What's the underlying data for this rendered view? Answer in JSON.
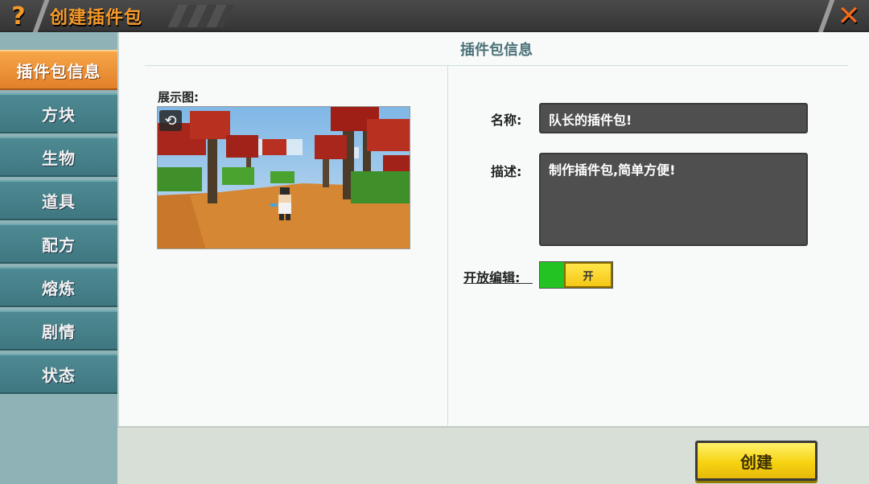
{
  "header": {
    "help_icon": "question-mark-icon",
    "help_glyph": "?",
    "title": "创建插件包",
    "close_icon": "close-icon",
    "close_glyph": "✕"
  },
  "sidebar": {
    "items": [
      {
        "label": "插件包信息",
        "active": true
      },
      {
        "label": "方块",
        "active": false
      },
      {
        "label": "生物",
        "active": false
      },
      {
        "label": "道具",
        "active": false
      },
      {
        "label": "配方",
        "active": false
      },
      {
        "label": "熔炼",
        "active": false
      },
      {
        "label": "剧情",
        "active": false
      },
      {
        "label": "状态",
        "active": false
      }
    ]
  },
  "panel": {
    "title": "插件包信息",
    "preview_label": "展示图:",
    "refresh_icon": "refresh-icon",
    "refresh_glyph": "⟲",
    "name_label": "名称:",
    "name_value": "队长的插件包!",
    "desc_label": "描述:",
    "desc_value": "制作插件包,简单方便!",
    "open_edit_label": "开放编辑:",
    "toggle_state": "开"
  },
  "footer": {
    "create_label": "创建"
  },
  "colors": {
    "accent_orange": "#f59a2a",
    "sidebar_teal": "#3f7780",
    "toggle_green": "#22c322",
    "button_yellow": "#f6d312"
  }
}
